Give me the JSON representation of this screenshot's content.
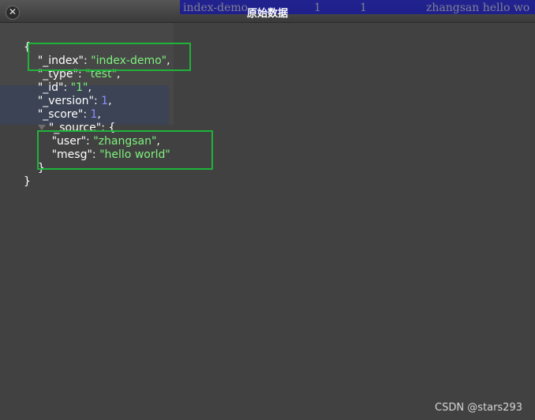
{
  "window": {
    "title": "原始数据",
    "close_icon": "close-icon"
  },
  "background_text": {
    "col1": "index-demo",
    "col2": "1",
    "col3": "1",
    "col4": "zhangsan  hello wo"
  },
  "json_view": {
    "open_brace": "{",
    "close_brace": "}",
    "fields": [
      {
        "key": "\"_index\"",
        "value": "\"index-demo\"",
        "type": "string"
      },
      {
        "key": "\"_type\"",
        "value": "\"test\"",
        "type": "string"
      },
      {
        "key": "\"_id\"",
        "value": "\"1\"",
        "type": "string"
      },
      {
        "key": "\"_version\"",
        "value": "1",
        "type": "number"
      },
      {
        "key": "\"_score\"",
        "value": "1",
        "type": "number"
      }
    ],
    "source": {
      "key": "\"_source\"",
      "open": "{",
      "close": "}",
      "fields": [
        {
          "key": "\"user\"",
          "value": "\"zhangsan\"",
          "type": "string"
        },
        {
          "key": "\"mesg\"",
          "value": "\"hello world\"",
          "type": "string"
        }
      ]
    }
  },
  "watermark": "CSDN @stars293",
  "colors": {
    "string": "#7ef27e",
    "number": "#8f8fff",
    "highlight_box": "#1fb33a",
    "background": "#414141"
  }
}
